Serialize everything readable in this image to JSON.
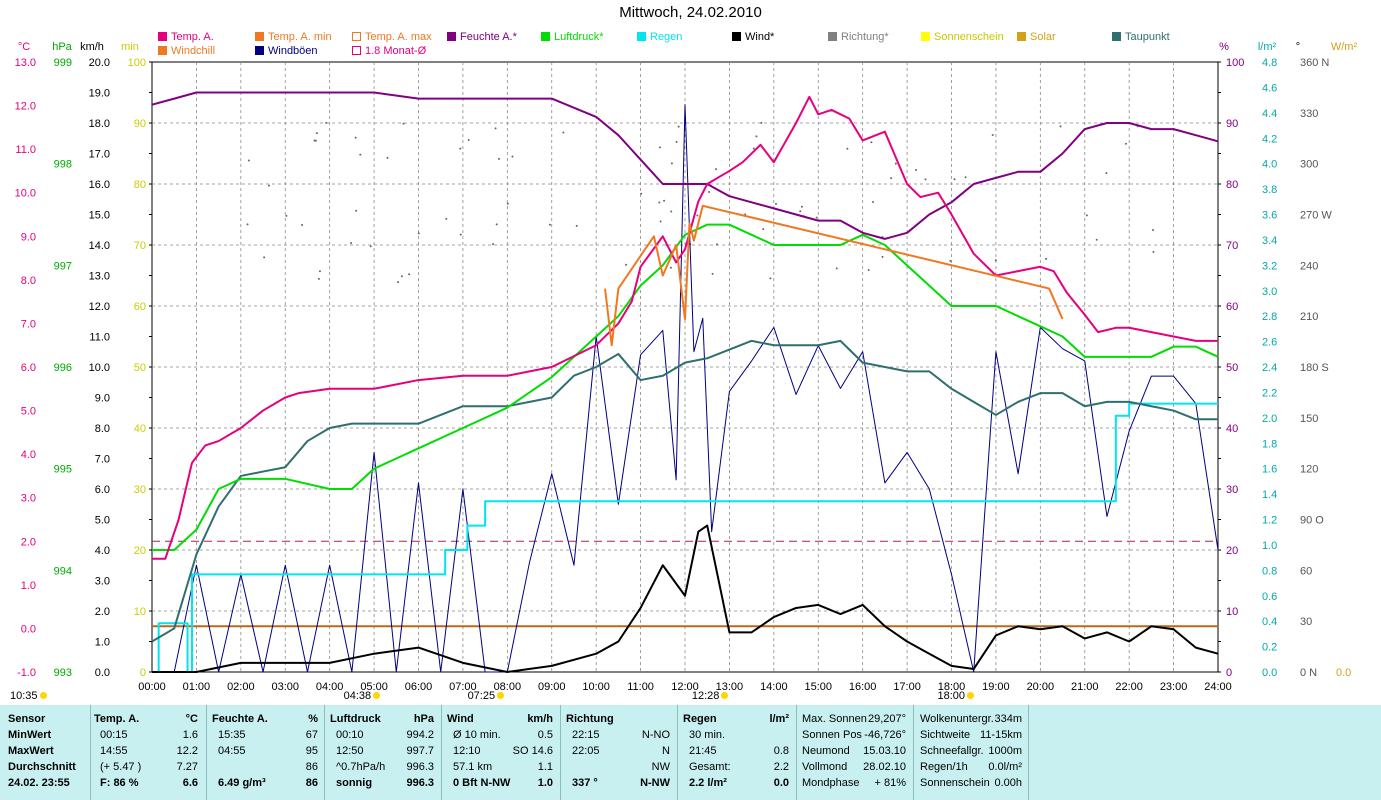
{
  "title": "Mittwoch, 24.02.2010",
  "legend_row1": [
    {
      "label": "Temp. A.",
      "color": "#e6007e",
      "x": 158
    },
    {
      "label": "Temp. A. min",
      "color": "#f07820",
      "x": 255
    },
    {
      "label": "Temp. A. max",
      "color": "#f07820",
      "x": 352,
      "hollow": true
    },
    {
      "label": "Feuchte A.*",
      "color": "#800080",
      "x": 447
    },
    {
      "label": "Luftdruck*",
      "color": "#00dd00",
      "x": 541
    },
    {
      "label": "Regen",
      "color": "#00e5ee",
      "x": 637
    },
    {
      "label": "Wind*",
      "color": "#000000",
      "x": 732
    },
    {
      "label": "Richtung*",
      "color": "#808080",
      "x": 828
    },
    {
      "label": "Sonnenschein",
      "color": "#ffff00",
      "x": 921
    },
    {
      "label": "Solar",
      "color": "#d4a017",
      "x": 1017
    },
    {
      "label": "Taupunkt",
      "color": "#2f6f6f",
      "x": 1112
    }
  ],
  "legend_row2": [
    {
      "label": "Windchill",
      "color": "#f07820",
      "x": 158
    },
    {
      "label": "Windböen",
      "color": "#000080",
      "x": 255
    },
    {
      "label": "1.8 Monat-Ø",
      "color": "#e6007e",
      "x": 352,
      "hollow": true
    }
  ],
  "left_axis_headers": [
    {
      "label": "°C",
      "color": "#e6007e"
    },
    {
      "label": "hPa",
      "color": "#00aa00"
    },
    {
      "label": "km/h",
      "color": "#000000"
    },
    {
      "label": "min",
      "color": "#cccc00"
    }
  ],
  "right_axis_headers": [
    {
      "label": "%",
      "color": "#800080"
    },
    {
      "label": "l/m²",
      "color": "#00aaaa"
    },
    {
      "label": "°",
      "color": "#000000"
    },
    {
      "label": "W/m²",
      "color": "#d4a017"
    }
  ],
  "axis_temp": [
    "13.0",
    "12.0",
    "11.0",
    "10.0",
    "9.0",
    "8.0",
    "7.0",
    "6.0",
    "5.0",
    "4.0",
    "3.0",
    "2.0",
    "1.0",
    "0.0",
    "-1.0"
  ],
  "axis_hpa": [
    "999",
    "998",
    "997",
    "996",
    "995",
    "994",
    "993"
  ],
  "axis_kmh": [
    "20.0",
    "19.0",
    "18.0",
    "17.0",
    "16.0",
    "15.0",
    "14.0",
    "13.0",
    "12.0",
    "11.0",
    "10.0",
    "9.0",
    "8.0",
    "7.0",
    "6.0",
    "5.0",
    "4.0",
    "3.0",
    "2.0",
    "1.0",
    "0.0"
  ],
  "axis_min": [
    "100",
    "90",
    "80",
    "70",
    "60",
    "50",
    "40",
    "30",
    "20",
    "10",
    "0"
  ],
  "axis_pct": [
    "100",
    "90",
    "80",
    "70",
    "60",
    "50",
    "40",
    "30",
    "20",
    "10",
    "0"
  ],
  "axis_rain": [
    "4.8",
    "4.6",
    "4.4",
    "4.2",
    "4.0",
    "3.8",
    "3.6",
    "3.4",
    "3.2",
    "3.0",
    "2.8",
    "2.6",
    "2.4",
    "2.2",
    "2.0",
    "1.8",
    "1.6",
    "1.4",
    "1.2",
    "1.0",
    "0.8",
    "0.6",
    "0.4",
    "0.2",
    "0.0"
  ],
  "axis_deg": [
    "360 N",
    "330",
    "300",
    "270 W",
    "240",
    "210",
    "180 S",
    "150",
    "120",
    "90  O",
    "60",
    "30",
    "0   N"
  ],
  "axis_wm2": [
    "1.0",
    "0.0"
  ],
  "x_ticks": [
    "00:00",
    "01:00",
    "02:00",
    "03:00",
    "04:00",
    "05:00",
    "06:00",
    "07:00",
    "08:00",
    "09:00",
    "10:00",
    "11:00",
    "12:00",
    "13:00",
    "14:00",
    "15:00",
    "16:00",
    "17:00",
    "18:00",
    "19:00",
    "20:00",
    "21:00",
    "22:00",
    "23:00",
    "24:00"
  ],
  "time_markers": [
    {
      "label": "10:35",
      "t": "left"
    },
    {
      "label": "04:38",
      "t": 4.63
    },
    {
      "label": "07:25",
      "t": 7.42
    },
    {
      "label": "12:28",
      "t": 12.47
    },
    {
      "label": "18:00",
      "t": 18.0
    }
  ],
  "chart_data": {
    "type": "line",
    "title": "Mittwoch, 24.02.2010",
    "x_unit": "hour",
    "xlim": [
      0,
      24
    ],
    "series": [
      {
        "name": "Temp. A.",
        "unit": "°C",
        "color": "#e6007e",
        "x": [
          0,
          0.3,
          0.6,
          0.9,
          1.2,
          1.5,
          2,
          2.5,
          3,
          3.3,
          4,
          5,
          6,
          7,
          8,
          8.5,
          9,
          10,
          10.5,
          10.8,
          11,
          11.5,
          11.8,
          12,
          12.3,
          12.5,
          13,
          13.3,
          13.7,
          14,
          14.5,
          14.8,
          15,
          15.3,
          15.7,
          16,
          16.5,
          17,
          17.3,
          17.7,
          18,
          18.5,
          19,
          19.5,
          20,
          20.3,
          20.6,
          21,
          21.3,
          21.7,
          22,
          22.5,
          23,
          23.5,
          24
        ],
        "y": [
          1.6,
          1.6,
          2.5,
          3.8,
          4.2,
          4.3,
          4.6,
          5.0,
          5.3,
          5.4,
          5.5,
          5.5,
          5.7,
          5.8,
          5.8,
          5.9,
          6.0,
          6.5,
          7.0,
          7.5,
          8.3,
          9.0,
          8.4,
          8.7,
          9.8,
          10.2,
          10.5,
          10.7,
          11.1,
          10.7,
          11.6,
          12.2,
          11.8,
          11.9,
          11.7,
          11.2,
          11.4,
          10.2,
          9.9,
          10.0,
          9.5,
          8.6,
          8.1,
          8.2,
          8.3,
          8.2,
          7.7,
          7.2,
          6.8,
          6.9,
          6.9,
          6.8,
          6.7,
          6.6,
          6.6
        ]
      },
      {
        "name": "Windchill",
        "unit": "°C",
        "color": "#f07820",
        "x": [
          10.2,
          10.35,
          10.5,
          11.3,
          11.5,
          11.8,
          12.0,
          12.1,
          12.2,
          12.4,
          20.2,
          20.5
        ],
        "y": [
          7.8,
          6.5,
          7.8,
          9.0,
          8.1,
          8.8,
          7.1,
          9.3,
          8.9,
          9.7,
          7.8,
          7.1
        ]
      },
      {
        "name": "Feuchte A.*",
        "unit": "%",
        "color": "#800080",
        "x": [
          0,
          0.5,
          1,
          2,
          3,
          4,
          5,
          6,
          7,
          8,
          9,
          10,
          10.5,
          11,
          11.5,
          12,
          12.5,
          13,
          13.5,
          14,
          14.5,
          15,
          15.5,
          16,
          16.5,
          17,
          17.5,
          18,
          18.5,
          19,
          19.5,
          20,
          20.5,
          21,
          21.5,
          22,
          22.5,
          23,
          23.5,
          24
        ],
        "y": [
          93,
          94,
          95,
          95,
          95,
          95,
          95,
          94,
          94,
          94,
          94,
          91,
          88,
          84,
          80,
          80,
          80,
          78,
          77,
          76,
          75,
          74,
          74,
          72,
          71,
          72,
          75,
          77,
          80,
          81,
          82,
          82,
          85,
          89,
          90,
          90,
          89,
          89,
          88,
          87
        ]
      },
      {
        "name": "Luftdruck*",
        "unit": "hPa",
        "color": "#00dd00",
        "x": [
          0,
          0.5,
          1,
          1.5,
          2,
          3,
          4,
          4.5,
          5,
          5.5,
          6,
          7,
          8,
          9,
          10,
          10.5,
          11,
          11.5,
          12,
          12.5,
          13,
          13.5,
          14,
          14.5,
          15,
          15.5,
          16,
          16.5,
          17,
          17.5,
          18,
          18.5,
          19,
          19.5,
          20,
          20.5,
          21,
          21.5,
          22,
          22.5,
          23,
          23.5,
          24
        ],
        "y": [
          994.2,
          994.2,
          994.4,
          994.8,
          994.9,
          994.9,
          994.8,
          994.8,
          995.0,
          995.1,
          995.2,
          995.4,
          995.6,
          995.9,
          996.3,
          996.5,
          996.8,
          997.0,
          997.3,
          997.4,
          997.4,
          997.3,
          997.2,
          997.2,
          997.2,
          997.2,
          997.3,
          997.2,
          997.0,
          996.8,
          996.6,
          996.6,
          996.6,
          996.5,
          996.4,
          996.3,
          996.1,
          996.1,
          996.1,
          996.1,
          996.2,
          996.2,
          996.1
        ]
      },
      {
        "name": "Regen",
        "unit": "l/m²",
        "color": "#00e5ee",
        "x": [
          0,
          0.1,
          0.15,
          0.2,
          0.7,
          0.8,
          0.9,
          1.0,
          6.5,
          6.6,
          7.0,
          7.1,
          7.4,
          7.5,
          21.6,
          21.7,
          22.0,
          24
        ],
        "y": [
          0,
          0,
          0.4,
          0.4,
          0.4,
          0,
          0.8,
          0.8,
          0.8,
          1.0,
          1.0,
          1.2,
          1.2,
          1.4,
          1.4,
          2.1,
          2.2,
          2.2
        ]
      },
      {
        "name": "Taupunkt",
        "unit": "°C",
        "color": "#2f6f6f",
        "x": [
          0,
          0.5,
          1,
          1.5,
          2,
          2.5,
          3,
          3.5,
          4,
          4.5,
          5,
          5.5,
          6,
          7,
          8,
          8.5,
          9,
          9.5,
          10,
          10.5,
          11,
          11.5,
          12,
          12.5,
          13,
          13.5,
          14,
          14.5,
          15,
          15.5,
          16,
          16.5,
          17,
          17.5,
          18,
          18.5,
          19,
          19.5,
          20,
          20.5,
          21,
          21.5,
          22,
          22.5,
          23,
          23.5,
          24
        ],
        "y": [
          -0.3,
          0.0,
          1.7,
          2.8,
          3.5,
          3.6,
          3.7,
          4.3,
          4.6,
          4.7,
          4.7,
          4.7,
          4.7,
          5.1,
          5.1,
          5.2,
          5.3,
          5.8,
          6.0,
          6.3,
          5.7,
          5.8,
          6.1,
          6.2,
          6.4,
          6.6,
          6.5,
          6.5,
          6.5,
          6.6,
          6.1,
          6.0,
          5.9,
          5.9,
          5.5,
          5.2,
          4.9,
          5.2,
          5.4,
          5.4,
          5.1,
          5.2,
          5.2,
          5.1,
          5.0,
          4.8,
          4.8
        ]
      },
      {
        "name": "Wind*",
        "unit": "km/h",
        "color": "#000000",
        "x": [
          0,
          1,
          2,
          3,
          4,
          5,
          6,
          7,
          8,
          9,
          10,
          10.5,
          11,
          11.5,
          12,
          12.3,
          12.5,
          13,
          13.5,
          14,
          14.5,
          15,
          15.5,
          16,
          16.5,
          17,
          17.5,
          18,
          18.5,
          19,
          19.5,
          20,
          20.5,
          21,
          21.5,
          22,
          22.5,
          23,
          23.5,
          24
        ],
        "y": [
          0,
          0,
          0.3,
          0.3,
          0.3,
          0.6,
          0.8,
          0.3,
          0,
          0.2,
          0.6,
          1.0,
          2.1,
          3.5,
          2.5,
          4.6,
          4.8,
          1.3,
          1.3,
          1.8,
          2.1,
          2.2,
          1.9,
          2.2,
          1.5,
          1.0,
          0.6,
          0.2,
          0.1,
          1.2,
          1.5,
          1.4,
          1.5,
          1.1,
          1.3,
          1.0,
          1.5,
          1.4,
          0.8,
          0.6
        ]
      },
      {
        "name": "Windböen",
        "unit": "km/h",
        "color": "#000080",
        "x": [
          0,
          0.5,
          1,
          1.5,
          2,
          2.5,
          3,
          3.5,
          4,
          4.5,
          5,
          5.5,
          6,
          6.5,
          7,
          7.5,
          8,
          8.5,
          9,
          9.5,
          10,
          10.5,
          11,
          11.5,
          11.8,
          12,
          12.2,
          12.4,
          12.6,
          13,
          13.5,
          14,
          14.5,
          15,
          15.5,
          16,
          16.5,
          17,
          17.5,
          18,
          18.5,
          19,
          19.5,
          20,
          20.5,
          21,
          21.5,
          22,
          22.5,
          23,
          23.5,
          24
        ],
        "y": [
          0,
          0,
          3.5,
          0,
          3.2,
          0,
          3.5,
          0,
          3.5,
          0,
          7.2,
          0,
          6.2,
          0,
          6.0,
          0,
          0,
          3.6,
          6.5,
          3.5,
          11.0,
          5.5,
          10.4,
          11.2,
          6.3,
          18.6,
          10.5,
          11.6,
          4.6,
          9.2,
          10.2,
          11.3,
          9.1,
          10.7,
          9.3,
          10.5,
          6.2,
          7.2,
          6.0,
          3.2,
          0,
          10.5,
          6.5,
          11.3,
          10.6,
          10.2,
          5.1,
          7.9,
          9.7,
          9.7,
          8.8,
          4.0
        ]
      }
    ],
    "direction_points_deg": "scattered around 240–330 (grey dots)",
    "reference_lines": [
      {
        "name": "1.8 Monat-Ø",
        "y_unit": "°C",
        "y": 2.0,
        "color": "#b0205a",
        "style": "dashed"
      },
      {
        "name": "Temp. A. min",
        "y_unit": "km/h",
        "y": 1.5,
        "color": "#c0661b",
        "style": "solid"
      }
    ],
    "grid": true
  },
  "stats": {
    "sensor": {
      "header": "Sensor",
      "rows": [
        "MinWert",
        "MaxWert",
        "Durchschnitt",
        "24.02. 23:55"
      ]
    },
    "temp": {
      "header": "Temp. A.",
      "unit": "°C",
      "rows": [
        [
          "00:15",
          "1.6"
        ],
        [
          "14:55",
          "12.2"
        ],
        [
          "(+ 5.47 )",
          "7.27"
        ],
        [
          "F: 86 %",
          "6.6"
        ]
      ]
    },
    "feuchte": {
      "header": "Feuchte A.",
      "unit": "%",
      "rows": [
        [
          "15:35",
          "67"
        ],
        [
          "04:55",
          "95"
        ],
        [
          "",
          "86"
        ],
        [
          "6.49 g/m³",
          "86"
        ]
      ]
    },
    "luftdruck": {
      "header": "Luftdruck",
      "unit": "hPa",
      "rows": [
        [
          "00:10",
          "994.2"
        ],
        [
          "12:50",
          "997.7"
        ],
        [
          "^0.7hPa/h",
          "996.3"
        ],
        [
          "sonnig",
          "996.3"
        ]
      ]
    },
    "wind": {
      "header": "Wind",
      "unit": "km/h",
      "rows": [
        [
          "Ø 10 min.",
          "0.5"
        ],
        [
          "12:10",
          "SO 14.6"
        ],
        [
          "57.1 km",
          "1.1"
        ],
        [
          "0 Bft N-NW",
          "1.0"
        ]
      ]
    },
    "richtung": {
      "header": "Richtung",
      "rows": [
        [
          "22:15",
          "N-NO"
        ],
        [
          "22:05",
          "N"
        ],
        [
          "",
          "NW"
        ],
        [
          "337 °",
          "N-NW"
        ]
      ]
    },
    "regen": {
      "header": "Regen",
      "unit": "l/m²",
      "rows": [
        [
          "30 min.",
          ""
        ],
        [
          "21:45",
          "0.8"
        ],
        [
          "Gesamt:",
          "2.2"
        ],
        [
          "2.2 l/m²",
          "0.0"
        ]
      ]
    },
    "sonne": {
      "rows": [
        [
          "Max. Sonnen",
          "29,207°"
        ],
        [
          "Sonnen Pos",
          "-46,726°"
        ],
        [
          "Neumond",
          "15.03.10"
        ],
        [
          "Vollmond",
          "28.02.10"
        ],
        [
          "Mondphase",
          "+ 81%"
        ]
      ]
    },
    "wolken": {
      "rows": [
        [
          "Wolkenuntergr.",
          "334m"
        ],
        [
          "Sichtweite",
          "11-15km"
        ],
        [
          "Schneefallgr.",
          "1000m"
        ],
        [
          "Regen/1h",
          "0.0l/m²"
        ],
        [
          "Sonnenschein",
          "0.00h"
        ]
      ]
    }
  }
}
